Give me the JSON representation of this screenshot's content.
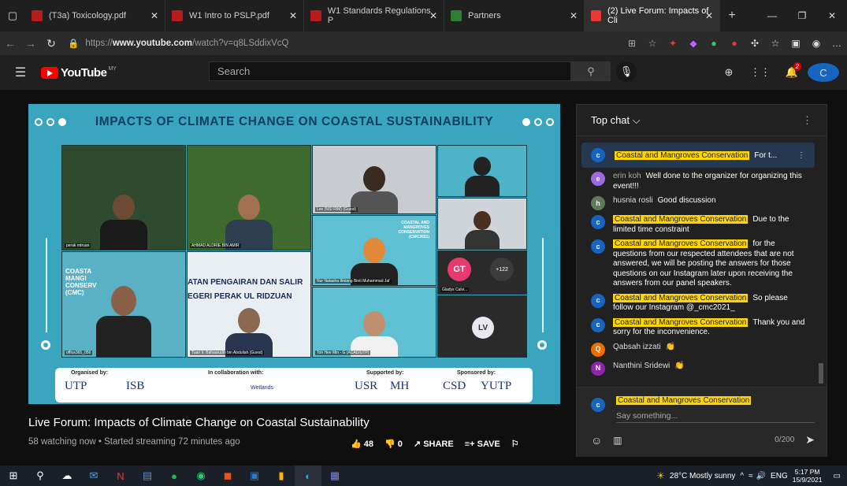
{
  "browser": {
    "tabs": [
      {
        "label": "(T3a) Toxicology.pdf",
        "color": "#b71c1c"
      },
      {
        "label": "W1 Intro to PSLP.pdf",
        "color": "#b71c1c"
      },
      {
        "label": "W1 Standards Regulations P",
        "color": "#b71c1c"
      },
      {
        "label": "Partners",
        "color": "#2e7d32"
      },
      {
        "label": "(2) Live Forum: Impacts of Cli",
        "color": "#e53935"
      }
    ],
    "url_prefix": "https://",
    "url_host": "www.youtube.com",
    "url_path": "/watch?v=q8LSddixVcQ"
  },
  "youtube": {
    "logo_text": "YouTube",
    "country": "MY",
    "search_placeholder": "Search",
    "notification_count": "2",
    "avatar_initial": "C"
  },
  "video": {
    "slide_title": "IMPACTS OF CLIMATE CHANGE ON COASTAL SUSTAINABILITY",
    "participants": {
      "p1": "perak mtruan",
      "p2": "AHMAD ALDRIE BIN AMIR",
      "p3": "Lee (NSI RIM) (Guest)",
      "p4": "Nur Natasha Ilmiang Binti Muhammad Jaf",
      "p5": "Gladys Calvi...",
      "p6": "office365_056",
      "p7": "Tuan Ir. Bahaarudin bin Abdullah (Guest)",
      "p8": "Toh Hee Min - G (ACAD/UTP)"
    },
    "gt": "GT",
    "plus_count": "+122",
    "lv": "LV",
    "coastal_text": "COASTAL AND MANGROVES CONSERVATION (CMC2021)",
    "left_text": "COASTA MANGI CONSERV (CMC)",
    "jps_text": "ATAN PENGAIRAN DAN SALIR EGERI PERAK UL RIDZUAN",
    "banner": {
      "organised": "Organised by:",
      "collab": "In collaboration with:",
      "supported": "Supported by:",
      "sponsored": "Sponsored by:",
      "logo_utp": "UTP",
      "logo_isb": "ISB",
      "logo_wetlands": "Wetlands",
      "logo_usr": "USR",
      "logo_mh": "MH",
      "logo_csd": "CSD",
      "logo_yutp": "YUTP"
    },
    "title": "Live Forum: Impacts of Climate Change on Coastal Sustainability",
    "meta": "58 watching now • Started streaming 72 minutes ago",
    "likes": "48",
    "dislikes": "0",
    "share": "SHARE",
    "save": "SAVE"
  },
  "chat": {
    "header": "Top chat",
    "pinned_author": "Coastal and Mangroves Conservation",
    "pinned_text": "For t...",
    "messages": [
      {
        "author": "erin koh",
        "text": "Well done to the organizer for organizing this event!!!",
        "color": "#9c6ade",
        "initial": "e",
        "hl": false
      },
      {
        "author": "husnia rosli",
        "text": "Good discussion",
        "color": "#5d7a5a",
        "initial": "h",
        "hl": false
      },
      {
        "author": "Coastal and Mangroves Conservation",
        "text": "Due to the limited time constraint",
        "color": "#1565c0",
        "initial": "C",
        "hl": true
      },
      {
        "author": "Coastal and Mangroves Conservation",
        "text": "for the questions from our respected attendees that are not answered, we will be posting the answers for those questions on our Instagram later upon receiving the answers from our panel speakers.",
        "color": "#1565c0",
        "initial": "C",
        "hl": true
      },
      {
        "author": "Coastal and Mangroves Conservation",
        "text": "So please follow our Instagram @_cmc2021_",
        "color": "#1565c0",
        "initial": "C",
        "hl": true
      },
      {
        "author": "Coastal and Mangroves Conservation",
        "text": "Thank you and sorry for the inconvenience.",
        "color": "#1565c0",
        "initial": "C",
        "hl": true
      },
      {
        "author": "Qabsah izzati",
        "text": "👏",
        "color": "#ef6c00",
        "initial": "Q",
        "hl": false
      },
      {
        "author": "Nanthini Sridewi",
        "text": "👏",
        "color": "#8e24aa",
        "initial": "N",
        "hl": false
      }
    ],
    "input_author": "Coastal and Mangroves Conservation",
    "input_placeholder": "Say something...",
    "char_count": "0/200"
  },
  "taskbar": {
    "weather": "28°C  Mostly sunny",
    "lang": "ENG",
    "time": "5:17 PM",
    "date": "15/9/2021"
  }
}
